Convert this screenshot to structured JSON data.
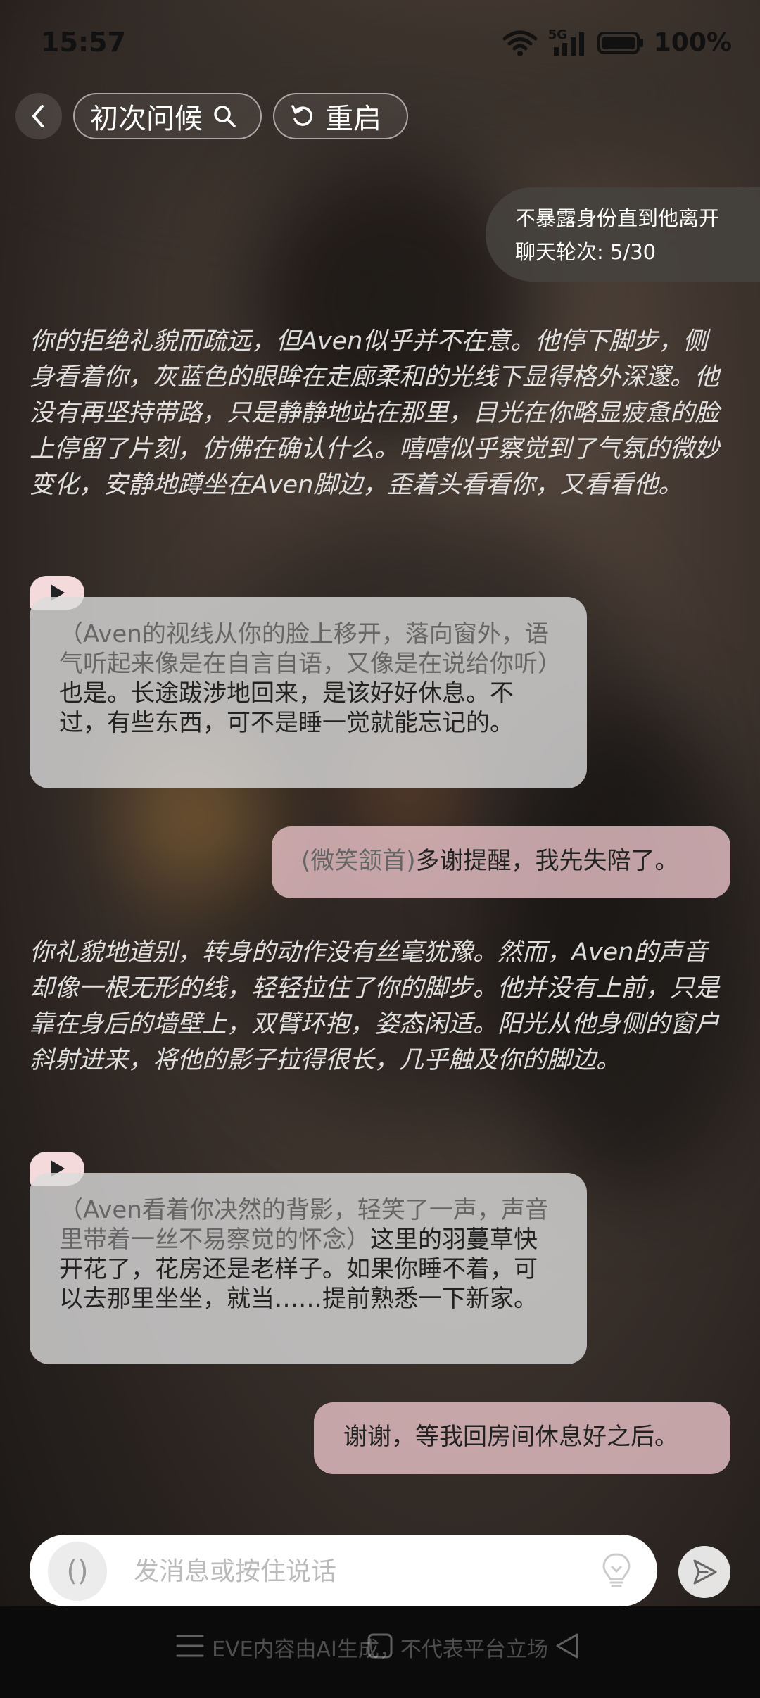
{
  "status_bar": {
    "time": "15:57",
    "network": "5G",
    "battery": "100%"
  },
  "header": {
    "scene_label": "初次问候",
    "restart_label": "重启"
  },
  "goal": {
    "objective": "不暴露身份直到他离开",
    "round_text": "聊天轮次: 5/30"
  },
  "messages": {
    "narration_1": "你的拒绝礼貌而疏远，但Aven似乎并不在意。他停下脚步，侧身看着你，灰蓝色的眼眸在走廊柔和的光线下显得格外深邃。他没有再坚持带路，只是静静地站在那里，目光在你略显疲惫的脸上停留了片刻，仿佛在确认什么。嘻嘻似乎察觉到了气氛的微妙变化，安静地蹲坐在Aven脚边，歪着头看看你，又看看他。",
    "ai_1_action": "（Aven的视线从你的脸上移开，落向窗外，语气听起来像是在自言自语，又像是在说给你听）",
    "ai_1_speech": "也是。长途跋涉地回来，是该好好休息。不过，有些东西，可不是睡一觉就能忘记的。",
    "user_1_action": "(微笑颔首)",
    "user_1_speech": "多谢提醒，我先失陪了。",
    "narration_2": "你礼貌地道别，转身的动作没有丝毫犹豫。然而，Aven的声音却像一根无形的线，轻轻拉住了你的脚步。他并没有上前，只是靠在身后的墙壁上，双臂环抱，姿态闲适。阳光从他身侧的窗户斜射进来，将他的影子拉得很长，几乎触及你的脚边。",
    "ai_2_action": "（Aven看着你决然的背影，轻笑了一声，声音里带着一丝不易察觉的怀念）",
    "ai_2_speech": "这里的羽蔓草快开花了，花房还是老样子。如果你睡不着，可以去那里坐坐，就当……提前熟悉一下新家。",
    "user_2_speech": "谢谢，等我回房间休息好之后。"
  },
  "input": {
    "placeholder": "发消息或按住说话",
    "voice_symbol": "()"
  },
  "footer": {
    "disclaimer": "EVE内容由AI生成，不代表平台立场"
  },
  "icons": {
    "back": "chevron-left-icon",
    "search": "search-icon",
    "restart": "refresh-icon",
    "play": "play-icon",
    "idea": "lightbulb-icon",
    "send": "send-icon",
    "wifi": "wifi-icon",
    "signal": "signal-icon",
    "battery": "battery-icon"
  }
}
